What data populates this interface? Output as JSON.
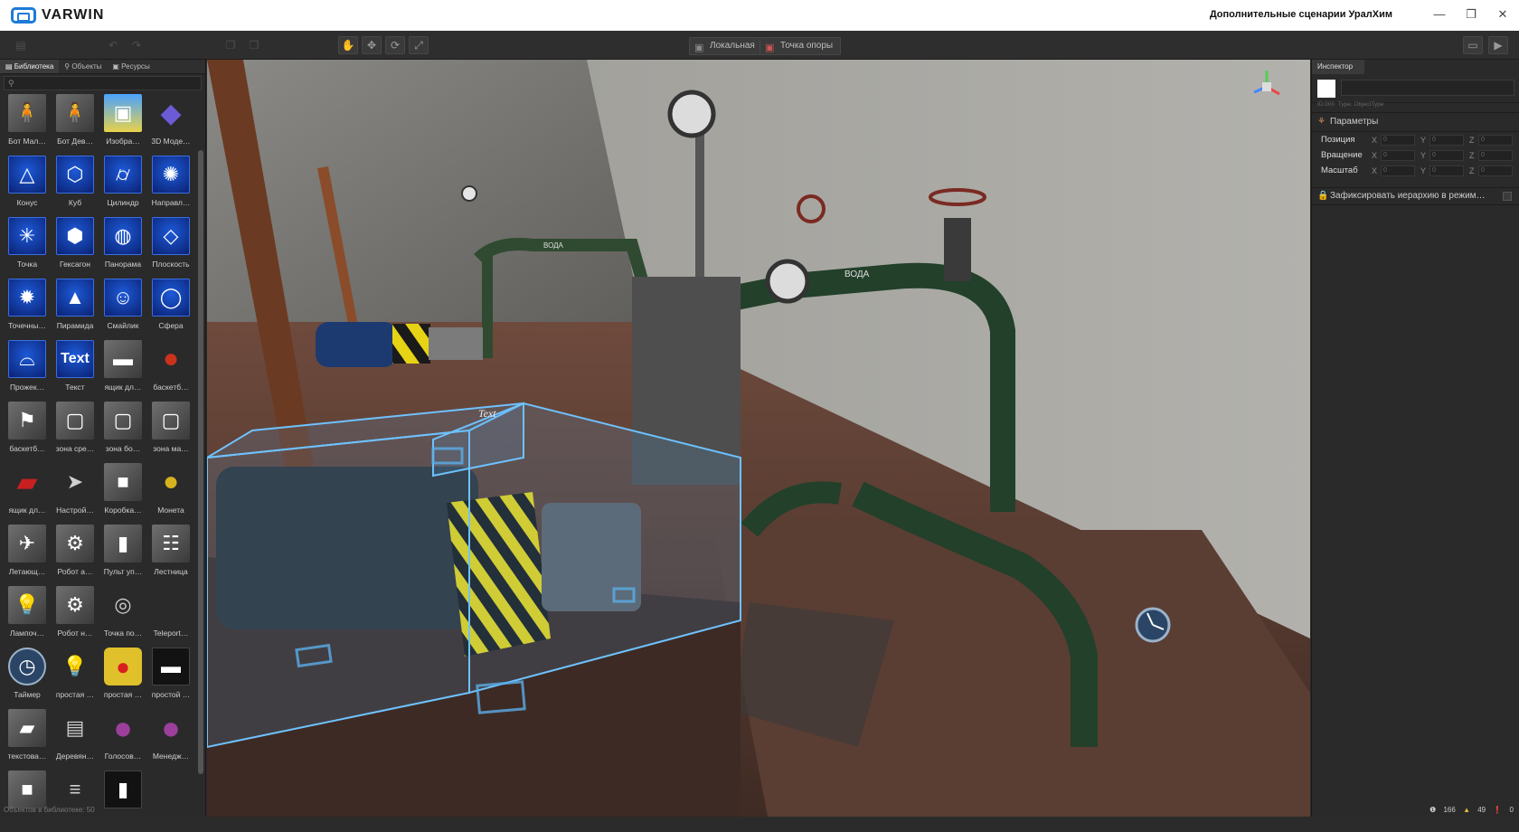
{
  "app": {
    "logo": "VARWIN",
    "project_title": "Дополнительные сценарии УралХим"
  },
  "window": {
    "minimize": "—",
    "restore": "❐",
    "close": "✕"
  },
  "toolbar": {
    "local_label": "Локальная",
    "pivot_label": "Точка опоры"
  },
  "library": {
    "tabs": [
      {
        "label": "Библиотека"
      },
      {
        "label": "Объекты"
      },
      {
        "label": "Ресурсы"
      }
    ],
    "search_placeholder": "",
    "items": [
      {
        "label": "Бот Мал…",
        "icon": "bot-male-icon",
        "glyph": "🧍",
        "style": "grey"
      },
      {
        "label": "Бот Дев…",
        "icon": "bot-female-icon",
        "glyph": "🧍",
        "style": "grey"
      },
      {
        "label": "Изобра…",
        "icon": "image-icon",
        "glyph": "▣",
        "style": "img"
      },
      {
        "label": "3D Моде…",
        "icon": "3d-model-icon",
        "glyph": "◆",
        "style": "model"
      },
      {
        "label": "Конус",
        "icon": "cone-icon",
        "glyph": "△",
        "style": "blue"
      },
      {
        "label": "Куб",
        "icon": "cube-icon",
        "glyph": "⬡",
        "style": "blue"
      },
      {
        "label": "Цилиндр",
        "icon": "cylinder-icon",
        "glyph": "⌭",
        "style": "blue"
      },
      {
        "label": "Направл…",
        "icon": "directional-light-icon",
        "glyph": "✺",
        "style": "blue"
      },
      {
        "label": "Точка",
        "icon": "point-icon",
        "glyph": "✳",
        "style": "blue"
      },
      {
        "label": "Гексагон",
        "icon": "hexagon-icon",
        "glyph": "⬢",
        "style": "blue"
      },
      {
        "label": "Панорама",
        "icon": "panorama-icon",
        "glyph": "◍",
        "style": "blue"
      },
      {
        "label": "Плоскость",
        "icon": "plane-icon",
        "glyph": "◇",
        "style": "blue"
      },
      {
        "label": "Точечны…",
        "icon": "point-light-icon",
        "glyph": "✹",
        "style": "blue"
      },
      {
        "label": "Пирамида",
        "icon": "pyramid-icon",
        "glyph": "▲",
        "style": "blue"
      },
      {
        "label": "Смайлик",
        "icon": "smiley-icon",
        "glyph": "☺",
        "style": "blue"
      },
      {
        "label": "Сфера",
        "icon": "sphere-icon",
        "glyph": "◯",
        "style": "blue"
      },
      {
        "label": "Прожек…",
        "icon": "spotlight-icon",
        "glyph": "⌓",
        "style": "blue"
      },
      {
        "label": "Текст",
        "icon": "text-icon",
        "glyph": "Text",
        "style": "blue"
      },
      {
        "label": "ящик дл…",
        "icon": "box-icon",
        "glyph": "▬",
        "style": "grey"
      },
      {
        "label": "баскетб…",
        "icon": "basketball-icon",
        "glyph": "●",
        "style": "ball"
      },
      {
        "label": "баскетб…",
        "icon": "basketball-hoop-icon",
        "glyph": "⚑",
        "style": "grey"
      },
      {
        "label": "зона сре…",
        "icon": "zone-icon",
        "glyph": "▢",
        "style": "grey"
      },
      {
        "label": "зона бо…",
        "icon": "zone-icon",
        "glyph": "▢",
        "style": "grey"
      },
      {
        "label": "зона ма…",
        "icon": "zone-icon",
        "glyph": "▢",
        "style": "grey"
      },
      {
        "label": "ящик дл…",
        "icon": "toolbox-icon",
        "glyph": "▰",
        "style": "red"
      },
      {
        "label": "Настрой…",
        "icon": "cursor-icon",
        "glyph": "➤",
        "style": "none"
      },
      {
        "label": "Коробка…",
        "icon": "crate-icon",
        "glyph": "■",
        "style": "grey"
      },
      {
        "label": "Монета",
        "icon": "coin-icon",
        "glyph": "●",
        "style": "coin"
      },
      {
        "label": "Летающ…",
        "icon": "drone-icon",
        "glyph": "✈",
        "style": "grey"
      },
      {
        "label": "Робот а…",
        "icon": "robot-arm-icon",
        "glyph": "⚙",
        "style": "grey"
      },
      {
        "label": "Пульт уп…",
        "icon": "control-panel-icon",
        "glyph": "▮",
        "style": "grey"
      },
      {
        "label": "Лестница",
        "icon": "ladder-icon",
        "glyph": "☷",
        "style": "grey"
      },
      {
        "label": "Лампоч…",
        "icon": "bulb-icon",
        "glyph": "💡",
        "style": "grey"
      },
      {
        "label": "Робот н…",
        "icon": "robot-icon",
        "glyph": "⚙",
        "style": "grey"
      },
      {
        "label": "Точка по…",
        "icon": "teleport-point-icon",
        "glyph": "◎",
        "style": "none"
      },
      {
        "label": "Teleport…",
        "icon": "teleport-icon",
        "glyph": "",
        "style": "none"
      },
      {
        "label": "Таймер",
        "icon": "timer-icon",
        "glyph": "◷",
        "style": "timer"
      },
      {
        "label": "простая …",
        "icon": "lamp-icon",
        "glyph": "💡",
        "style": "none"
      },
      {
        "label": "простая …",
        "icon": "red-button-icon",
        "glyph": "●",
        "style": "redbtn"
      },
      {
        "label": "простой …",
        "icon": "screen-icon",
        "glyph": "▬",
        "style": "dark"
      },
      {
        "label": "текстова…",
        "icon": "text-panel-icon",
        "glyph": "▰",
        "style": "grey"
      },
      {
        "label": "Деревян…",
        "icon": "bench-icon",
        "glyph": "▤",
        "style": "none"
      },
      {
        "label": "Голосов…",
        "icon": "voice-icon",
        "glyph": "●",
        "style": "purple"
      },
      {
        "label": "Менедж…",
        "icon": "manager-icon",
        "glyph": "●",
        "style": "purple"
      },
      {
        "label": "",
        "icon": "block-icon",
        "glyph": "■",
        "style": "grey"
      },
      {
        "label": "",
        "icon": "rails-icon",
        "glyph": "≡",
        "style": "none"
      },
      {
        "label": "",
        "icon": "panel-icon",
        "glyph": "▮",
        "style": "dark"
      },
      {
        "label": "",
        "icon": "empty-icon",
        "glyph": "",
        "style": "none"
      }
    ],
    "footer": "Объектов в библиотеке: 50"
  },
  "scene": {
    "text_label_1": "Text",
    "pipe_label_1": "ВОДА",
    "pipe_label_2": "ВОДА"
  },
  "inspector": {
    "tab": "Инспектор",
    "id_text": "ID:000",
    "type_text": "Type: ObjectType",
    "section_title": "Параметры",
    "rows": [
      {
        "label": "Позиция",
        "x": "0",
        "y": "0",
        "z": "0"
      },
      {
        "label": "Вращение",
        "x": "0",
        "y": "0",
        "z": "0"
      },
      {
        "label": "Масштаб",
        "x": "0",
        "y": "0",
        "z": "0"
      }
    ],
    "axes": {
      "x": "X",
      "y": "Y",
      "z": "Z"
    },
    "lock_label": "Зафиксировать иерархию в режим…"
  },
  "status": {
    "info": "166",
    "warnings": "49",
    "errors": "0"
  }
}
